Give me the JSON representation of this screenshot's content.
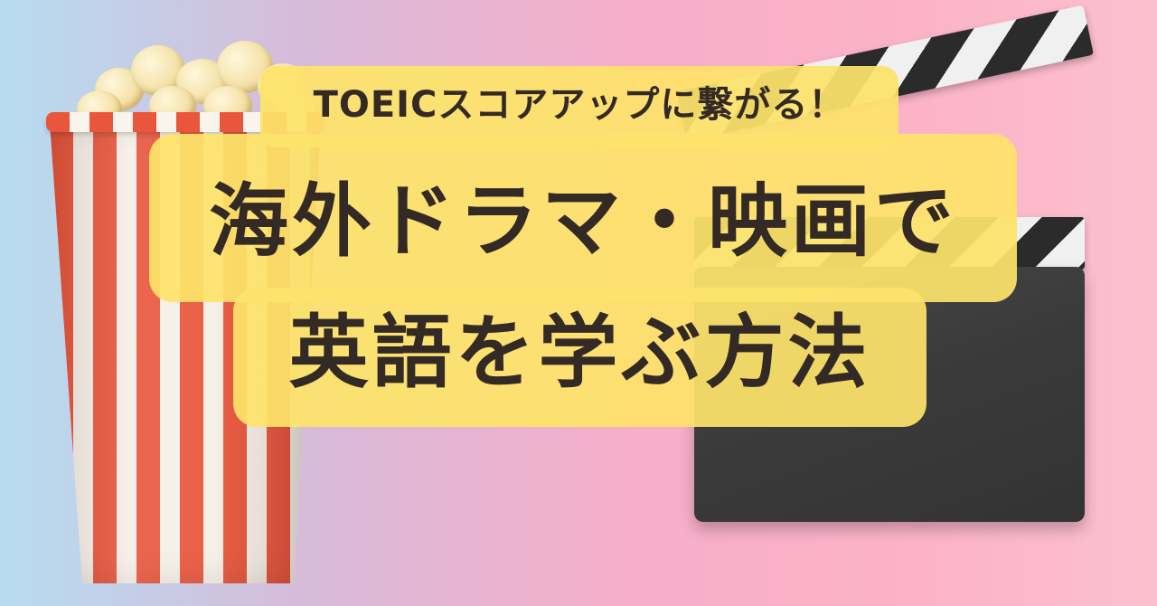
{
  "banner": {
    "subtitle": "TOEICスコアアップに繋がる！",
    "title_line1": "海外ドラマ・映画で",
    "title_line2": "英語を学ぶ方法"
  },
  "colors": {
    "highlight": "#fde36a",
    "text": "#342a25",
    "popcorn_stripe_red": "#e9563c",
    "popcorn_stripe_white": "#f6efe6",
    "clapper_body": "#3b3b3b"
  },
  "icons": [
    "popcorn-bucket-icon",
    "clapperboard-icon"
  ]
}
